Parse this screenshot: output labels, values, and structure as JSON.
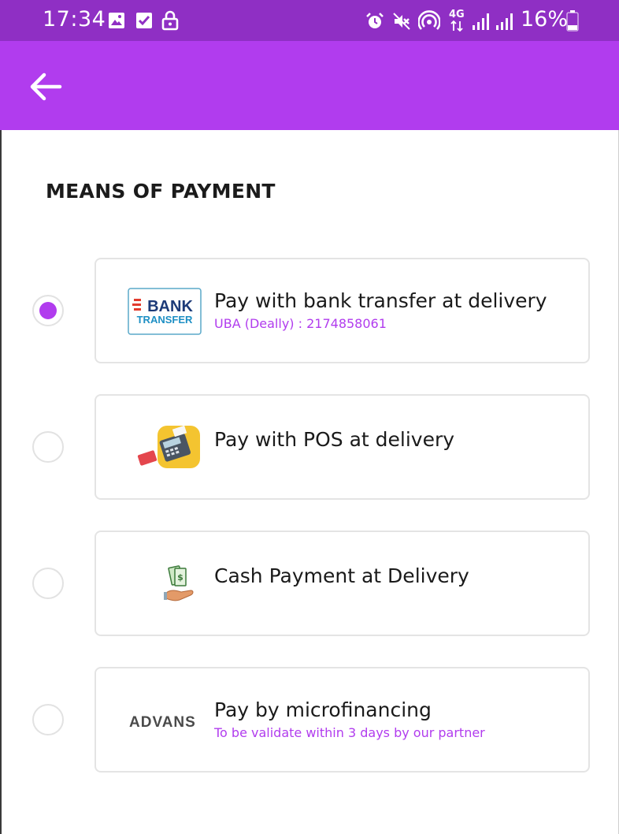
{
  "status_bar": {
    "time": "17:34",
    "network": "4G",
    "battery_percent": "16%",
    "icons": [
      "image-icon",
      "check-box-icon",
      "lock-icon",
      "alarm-icon",
      "mute-icon",
      "hotspot-icon",
      "signal-icon",
      "battery-icon"
    ]
  },
  "app_bar": {
    "back_icon": "arrow-left-icon",
    "color": "#b13cee"
  },
  "section_title": "MEANS OF PAYMENT",
  "payment_options": [
    {
      "logo": "bank-transfer-logo",
      "logo_text_top": "BANK",
      "logo_text_bottom": "TRANSFER",
      "label": "Pay with bank transfer at delivery",
      "subtitle": "UBA (Deally) : 2174858061",
      "selected": true
    },
    {
      "logo": "pos-terminal-icon",
      "label": "Pay with POS at delivery",
      "selected": false
    },
    {
      "logo": "cash-hand-icon",
      "label": "Cash Payment at Delivery",
      "selected": false
    },
    {
      "logo": "advans-logo",
      "logo_text": "ADVANS",
      "label": "Pay by microfinancing",
      "subtitle": "To be validate within 3 days by our partner",
      "selected": false
    }
  ],
  "colors": {
    "accent": "#b13cee",
    "status_bar": "#8f2fc4",
    "card_border": "#e4e4e4"
  }
}
